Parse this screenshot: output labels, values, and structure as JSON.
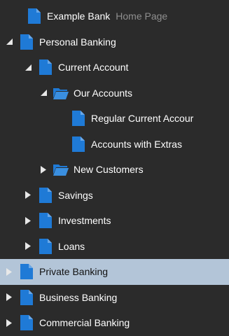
{
  "colors": {
    "background": "#2b2b2b",
    "selected_row": "#b3c5d8",
    "page_icon": "#1f7ad6",
    "folder_icon": "#1f7ad6",
    "muted_text": "#8f8f8f"
  },
  "tree": {
    "items": [
      {
        "label": "Example Bank",
        "sublabel": "Home Page",
        "icon": "page-icon",
        "toggle": "none",
        "depth": 0
      },
      {
        "label": "Personal Banking",
        "icon": "page-icon",
        "toggle": "expanded",
        "depth": 0
      },
      {
        "label": "Current Account",
        "icon": "page-icon",
        "toggle": "expanded",
        "depth": 1
      },
      {
        "label": "Our Accounts",
        "icon": "folder-open-icon",
        "toggle": "expanded",
        "depth": 2
      },
      {
        "label": "Regular Current Accour",
        "icon": "page-icon",
        "toggle": "none",
        "depth": 3
      },
      {
        "label": "Accounts with Extras",
        "icon": "page-icon",
        "toggle": "none",
        "depth": 3
      },
      {
        "label": "New Customers",
        "icon": "folder-open-icon",
        "toggle": "collapsed",
        "depth": 2
      },
      {
        "label": "Savings",
        "icon": "page-icon",
        "toggle": "collapsed",
        "depth": 1
      },
      {
        "label": "Investments",
        "icon": "page-icon",
        "toggle": "collapsed",
        "depth": 1
      },
      {
        "label": "Loans",
        "icon": "page-icon",
        "toggle": "collapsed",
        "depth": 1
      },
      {
        "label": "Private Banking",
        "icon": "page-icon",
        "toggle": "collapsed",
        "depth": 0,
        "selected": true
      },
      {
        "label": "Business Banking",
        "icon": "page-icon",
        "toggle": "collapsed",
        "depth": 0
      },
      {
        "label": "Commercial Banking",
        "icon": "page-icon",
        "toggle": "collapsed",
        "depth": 0
      }
    ]
  }
}
